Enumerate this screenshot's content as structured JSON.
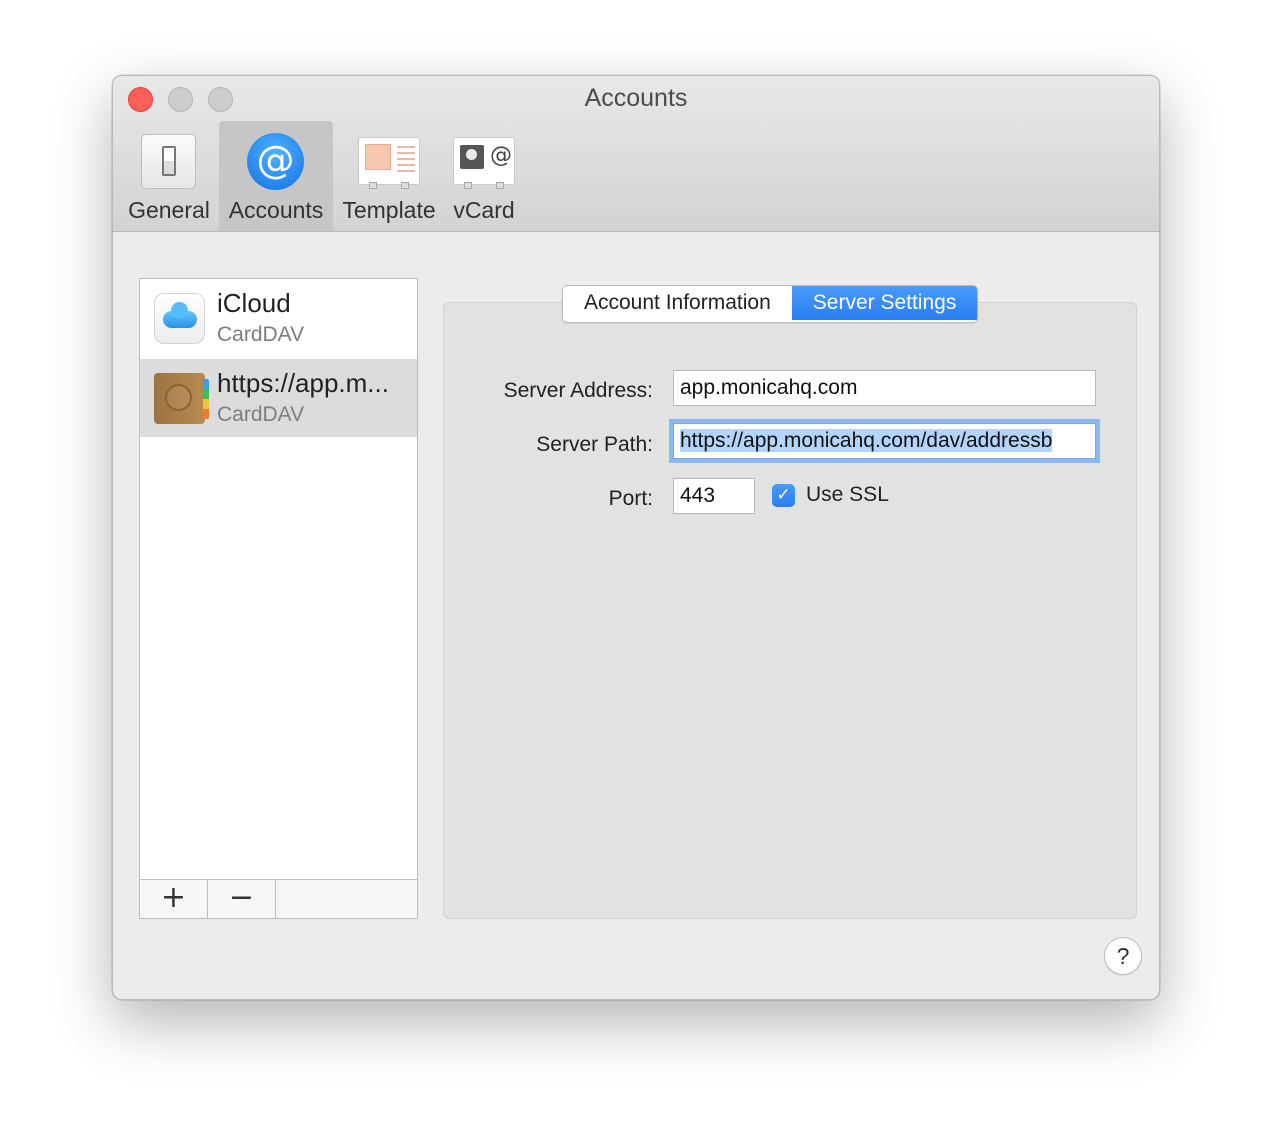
{
  "window": {
    "title": "Accounts"
  },
  "toolbar": {
    "general_label": "General",
    "accounts_label": "Accounts",
    "template_label": "Template",
    "vcard_label": "vCard"
  },
  "accounts": [
    {
      "name": "iCloud",
      "type": "CardDAV",
      "icon": "icloud-icon"
    },
    {
      "name": "https://app.m...",
      "type": "CardDAV",
      "icon": "address-book-icon",
      "selected": true
    }
  ],
  "list_toolbar": {
    "add_label": "+",
    "remove_label": "−"
  },
  "tabs": {
    "account_information": "Account Information",
    "server_settings": "Server Settings",
    "active": "Server Settings"
  },
  "server_settings": {
    "server_address_label": "Server Address:",
    "server_address_value": "app.monicahq.com",
    "server_path_label": "Server Path:",
    "server_path_value": "https://app.monicahq.com/dav/addressb",
    "port_label": "Port:",
    "port_value": "443",
    "use_ssl_label": "Use SSL",
    "use_ssl_checked": true
  },
  "help": {
    "label": "?"
  },
  "colors": {
    "accent": "#2a7df0",
    "close": "#ff5f57"
  }
}
